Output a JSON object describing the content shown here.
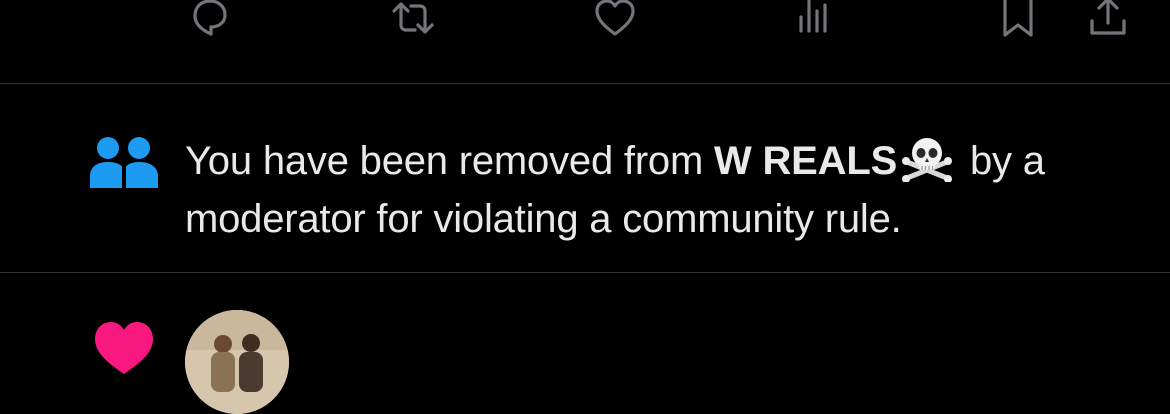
{
  "action_bar": {
    "icons": [
      "reply-icon",
      "repost-icon",
      "like-icon",
      "views-icon",
      "bookmark-icon",
      "share-icon"
    ]
  },
  "notification": {
    "icon": "community-people-icon",
    "icon_color": "#1d9bf0",
    "text_before": "You have been removed from ",
    "community_name": "W REALS",
    "emoji": "skull-and-crossbones-icon",
    "text_after": " by a moderator for violating a community rule."
  },
  "next_notification": {
    "icon": "heart-icon",
    "icon_color": "#f91880",
    "avatar": "avatar"
  },
  "colors": {
    "background": "#000000",
    "text": "#e7e9ea",
    "icon_gray": "#71767b",
    "divider": "#2f3336"
  }
}
